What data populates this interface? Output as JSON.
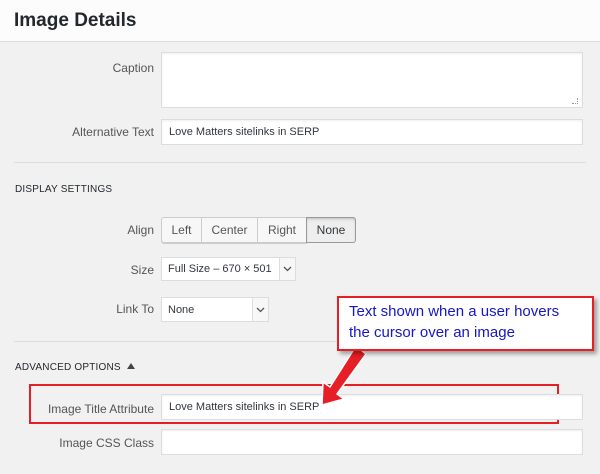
{
  "header": {
    "title": "Image Details"
  },
  "fields": {
    "caption_label": "Caption",
    "caption_value": "",
    "alt_label": "Alternative Text",
    "alt_value": "Love Matters sitelinks in SERP"
  },
  "display_settings": {
    "heading": "DISPLAY SETTINGS",
    "align_label": "Align",
    "align_options": [
      "Left",
      "Center",
      "Right",
      "None"
    ],
    "align_selected": "None",
    "size_label": "Size",
    "size_value": "Full Size – 670 × 501",
    "link_label": "Link To",
    "link_value": "None"
  },
  "advanced": {
    "heading": "ADVANCED OPTIONS",
    "title_attr_label": "Image Title Attribute",
    "title_attr_value": "Love Matters sitelinks in SERP",
    "css_class_label": "Image CSS Class",
    "css_class_value": ""
  },
  "annotation": {
    "line1": "Text shown when a user hovers",
    "line2": "the cursor over an image",
    "color": "#e61e25",
    "text_color": "#1616c8"
  },
  "icons": {
    "collapse": "triangle-up-icon",
    "dropdown": "chevron-down-icon"
  }
}
